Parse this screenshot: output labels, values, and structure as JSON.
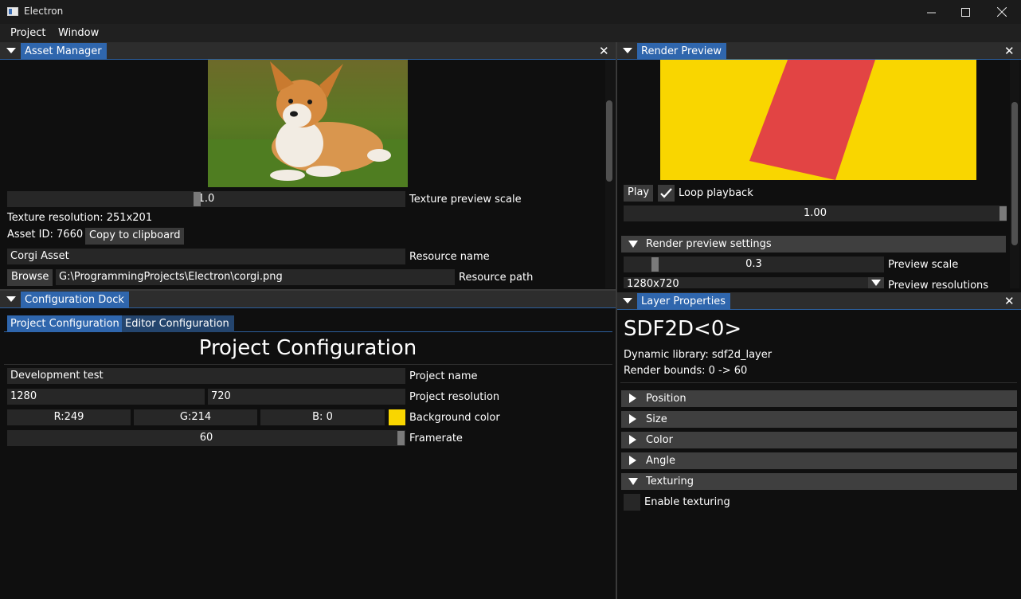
{
  "window": {
    "title": "Electron"
  },
  "menu": [
    "Project",
    "Window"
  ],
  "asset_manager": {
    "tab": "Asset Manager",
    "texture_scale_value": "1.0",
    "texture_scale_label": "Texture preview scale",
    "texture_resolution": "Texture resolution: 251x201",
    "asset_id": "Asset ID: 7660",
    "copy_button": "Copy to clipboard",
    "resource_name_value": "Corgi Asset",
    "resource_name_label": "Resource name",
    "browse_button": "Browse",
    "resource_path_value": "G:\\ProgrammingProjects\\Electron\\corgi.png",
    "resource_path_label": "Resource path"
  },
  "render_preview": {
    "tab": "Render Preview",
    "play_button": "Play",
    "loop_label": "Loop playback",
    "loop_checked": true,
    "time_value": "1.00",
    "settings_header": "Render preview settings",
    "preview_scale_value": "0.3",
    "preview_scale_label": "Preview scale",
    "resolution_value": "1280x720",
    "resolution_label": "Preview resolutions",
    "colors": {
      "background": "#f9d600",
      "shape": "#e24444"
    }
  },
  "config_dock": {
    "tab": "Configuration Dock",
    "subtabs": [
      "Project Configuration",
      "Editor Configuration"
    ],
    "heading": "Project Configuration",
    "project_name_value": "Development test",
    "project_name_label": "Project name",
    "res_w": "1280",
    "res_h": "720",
    "resolution_label": "Project resolution",
    "color_r": "R:249",
    "color_g": "G:214",
    "color_b": "B:  0",
    "bg_color_label": "Background color",
    "bg_color": "#f9d600",
    "framerate_value": "60",
    "framerate_label": "Framerate"
  },
  "layer_props": {
    "tab": "Layer Properties",
    "title": "SDF2D<0>",
    "dynamic_library": "Dynamic library: sdf2d_layer",
    "render_bounds": "Render bounds: 0 -> 60",
    "sections": [
      "Position",
      "Size",
      "Color",
      "Angle",
      "Texturing"
    ],
    "enable_texturing": "Enable texturing"
  },
  "icons": {
    "minimize": "minimize-icon",
    "maximize": "maximize-icon",
    "close": "close-icon"
  }
}
